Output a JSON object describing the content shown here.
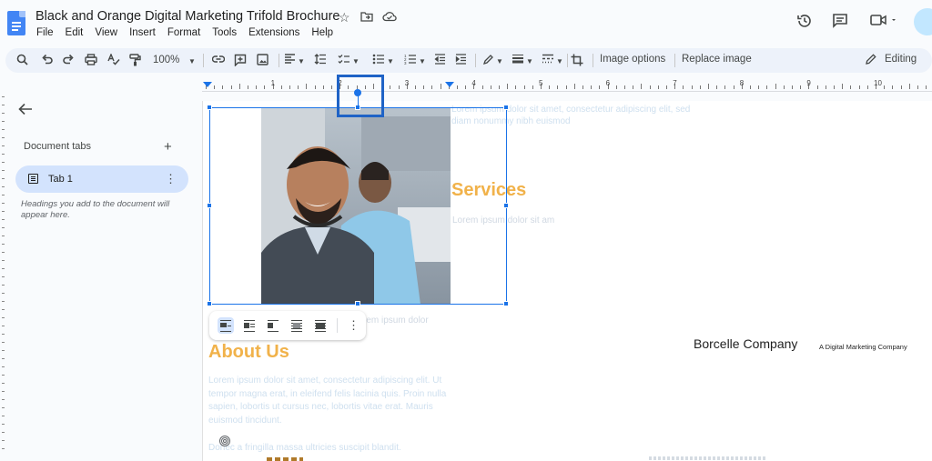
{
  "app": {
    "title": "Black and Orange Digital Marketing Trifold Brochure",
    "menus": [
      "File",
      "Edit",
      "View",
      "Insert",
      "Format",
      "Tools",
      "Extensions",
      "Help"
    ]
  },
  "toolbar": {
    "zoom": "100%",
    "image_options_label": "Image options",
    "replace_image_label": "Replace image",
    "editing_label": "Editing"
  },
  "ruler": {
    "numbers": [
      "1",
      "2",
      "3",
      "4",
      "5",
      "6",
      "7",
      "8",
      "9",
      "10"
    ]
  },
  "sidebar": {
    "heading": "Document tabs",
    "tab_label": "Tab 1",
    "hint": "Headings you add to the document will appear here."
  },
  "document": {
    "faint_top": "Lorem ipsum dolor sit amet, consectetur adipiscing elit, sed diam nonummy nibh euismod",
    "services_heading": "Services",
    "services_text": "Lorem ipsum dolor sit am",
    "lorem_mid": "rem ipsum dolor",
    "about_heading": "About Us",
    "about_text": "Lorem ipsum dolor sit amet, consectetur adipiscing elit. Ut tempor magna erat, in eleifend felis lacinia quis. Proin nulla sapien, lobortis ut cursus nec, lobortis vitae erat. Mauris euismod tincidunt.",
    "faint_bottom": "Donec a fringilla massa ultricies suscipit blandit.",
    "company_name": "Borcelle Company",
    "company_tagline": "A Digital Marketing Company"
  },
  "colors": {
    "accent_blue": "#1a73e8",
    "heading_orange": "#f1b24a",
    "tab_selected": "#d3e3fd"
  }
}
